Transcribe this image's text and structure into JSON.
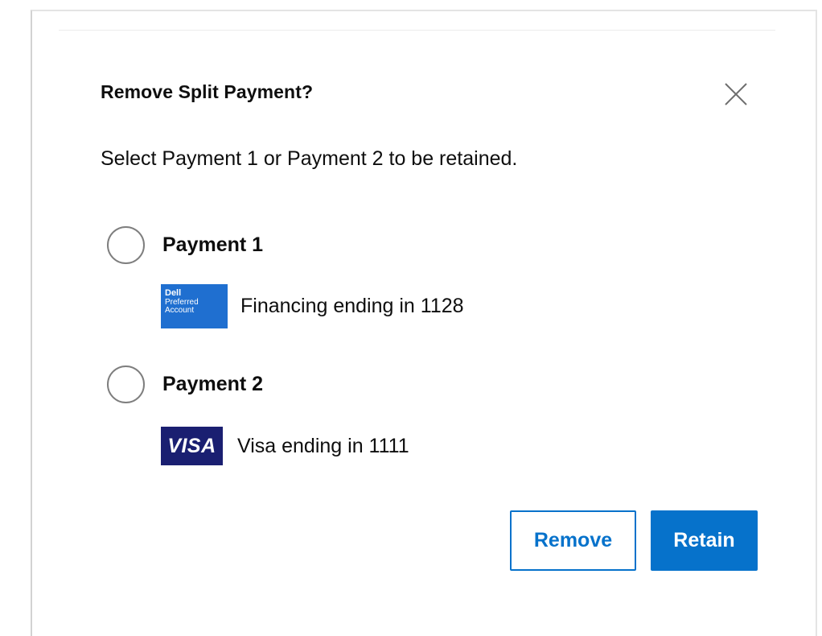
{
  "dialog": {
    "title": "Remove Split Payment?",
    "instructions": "Select Payment 1 or Payment 2 to be retained.",
    "close_icon": "close-icon"
  },
  "options": [
    {
      "label": "Payment 1",
      "selected": false,
      "method_text": "Financing ending in 1128",
      "logo": {
        "type": "dell-preferred-account",
        "line1": "Dell",
        "line2": "Preferred",
        "line3": "Account"
      }
    },
    {
      "label": "Payment 2",
      "selected": false,
      "method_text": "Visa ending in 1111",
      "logo": {
        "type": "visa",
        "text": "VISA"
      }
    }
  ],
  "actions": {
    "remove_label": "Remove",
    "retain_label": "Retain"
  },
  "colors": {
    "accent": "#0672cb",
    "visa_navy": "#1a1f71",
    "dell_blue": "#1f6fd0",
    "radio_border": "#7e7e7e"
  }
}
